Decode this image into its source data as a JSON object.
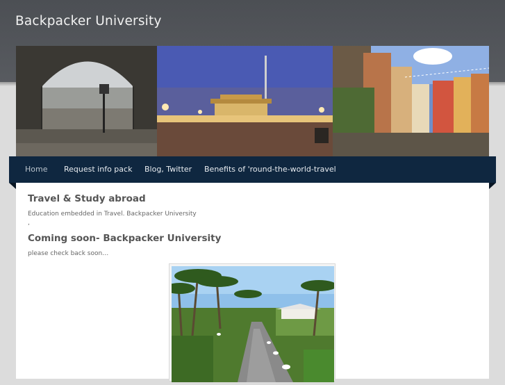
{
  "site": {
    "title": "Backpacker University"
  },
  "nav": {
    "items": [
      {
        "label": "Home",
        "active": true
      },
      {
        "label": "Request info pack",
        "active": false
      },
      {
        "label": "Blog, Twitter",
        "active": false
      },
      {
        "label": "Benefits of 'round-the-world-travel",
        "active": false
      }
    ]
  },
  "main": {
    "post1": {
      "title": "Travel & Study abroad",
      "text": "Education embedded in Travel.  Backpacker University",
      "extra": ","
    },
    "post2": {
      "title": "Coming soon- Backpacker University",
      "text": "please check back soon…"
    }
  },
  "colors": {
    "header": "#4c4f54",
    "nav": "#0f2740",
    "page_bg": "#dcdcdc"
  }
}
